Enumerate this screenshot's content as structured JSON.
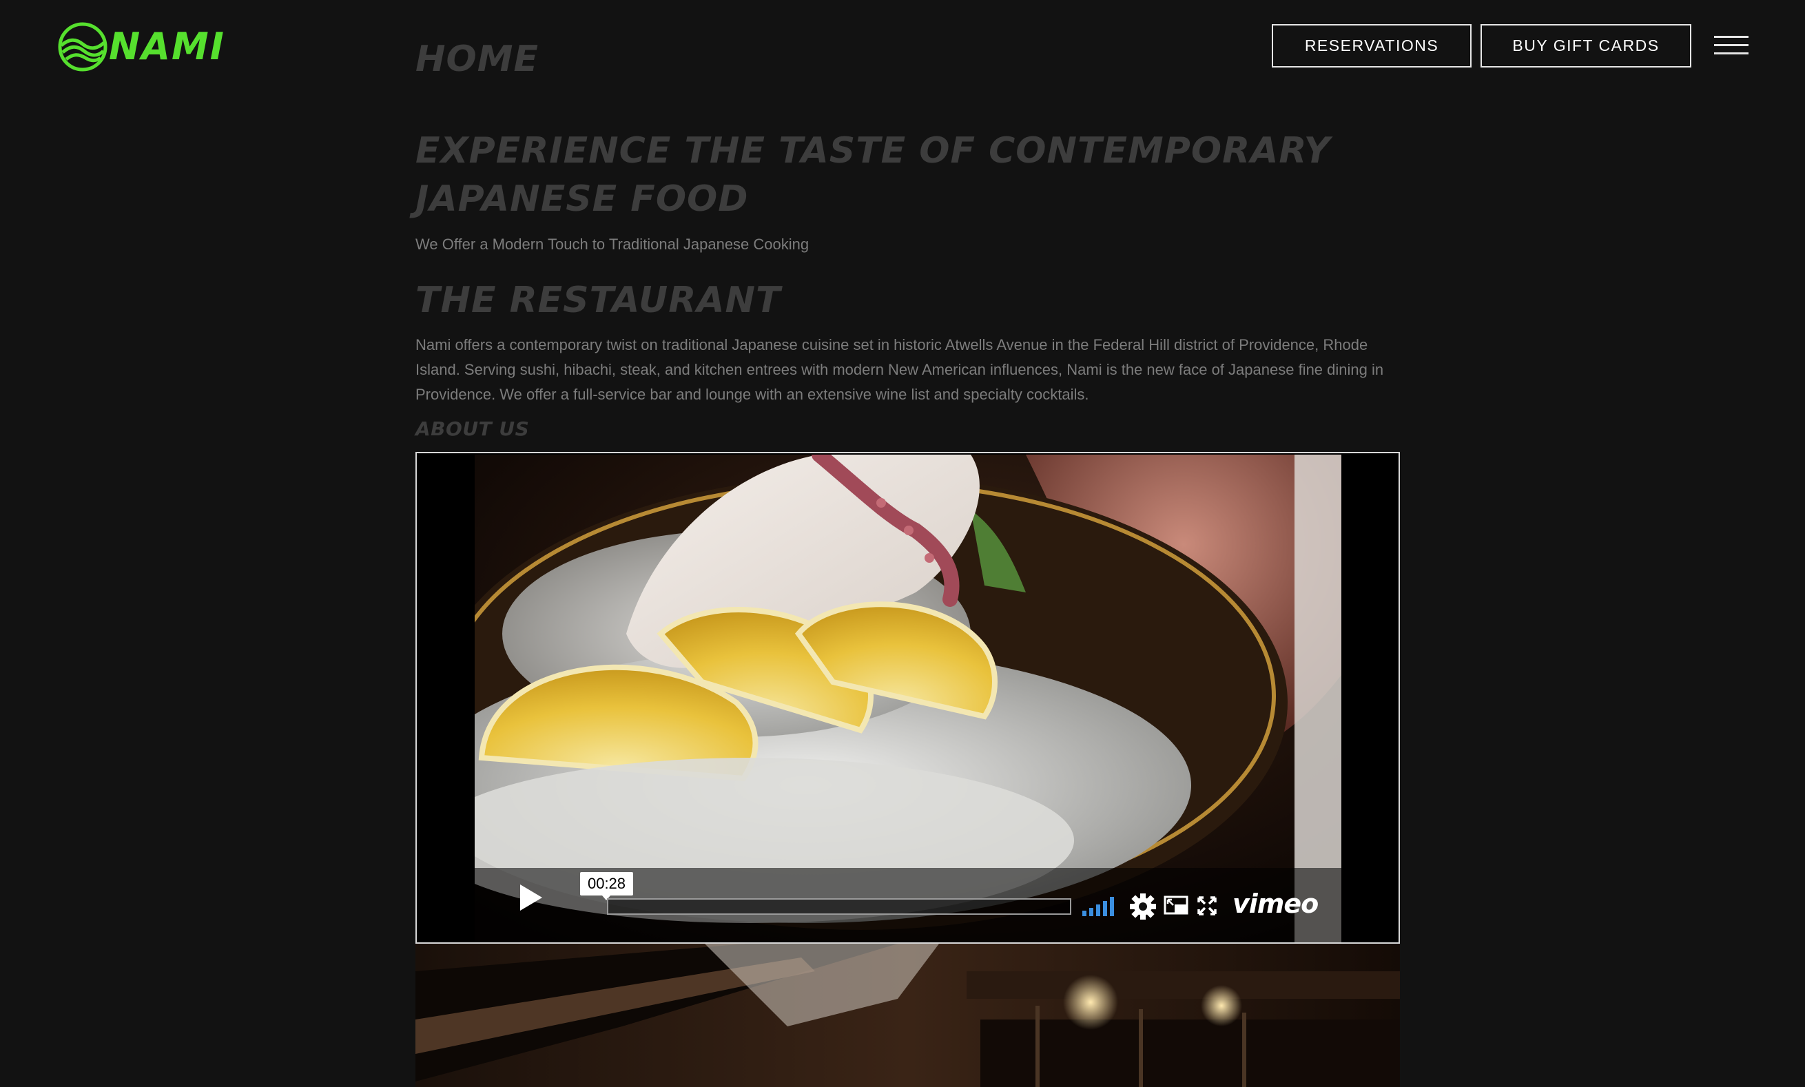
{
  "brand": {
    "name": "NAMI",
    "logo_color": "#56e02e"
  },
  "header": {
    "reservations_label": "RESERVATIONS",
    "gift_cards_label": "BUY GIFT CARDS",
    "menu_icon": "hamburger-menu-icon"
  },
  "page": {
    "title": "HOME"
  },
  "hero": {
    "title": "EXPERIENCE THE TASTE OF CONTEMPORARY JAPANESE FOOD",
    "subtitle": "We Offer a Modern Touch to Traditional Japanese Cooking"
  },
  "restaurant": {
    "title": "THE RESTAURANT",
    "body": "Nami offers a contemporary twist on traditional Japanese cuisine set in historic Atwells Avenue in the Federal Hill district of Providence, Rhode Island. Serving sushi, hibachi, steak, and kitchen entrees with modern New American influences, Nami is the new face of Japanese fine dining in Providence. We offer a full-service bar and lounge with an extensive wine list and specialty cocktails."
  },
  "about": {
    "label": "ABOUT US"
  },
  "video": {
    "time": "00:28",
    "progress_fraction": 0,
    "provider": "vimeo",
    "icons": [
      "play-icon",
      "volume-icon",
      "settings-gear-icon",
      "picture-in-picture-icon",
      "fullscreen-icon"
    ]
  },
  "colors": {
    "background": "#121212",
    "heading": "#3d3d3d",
    "body_text": "#7c7c7c",
    "volume_blue": "#3b8fe0"
  }
}
